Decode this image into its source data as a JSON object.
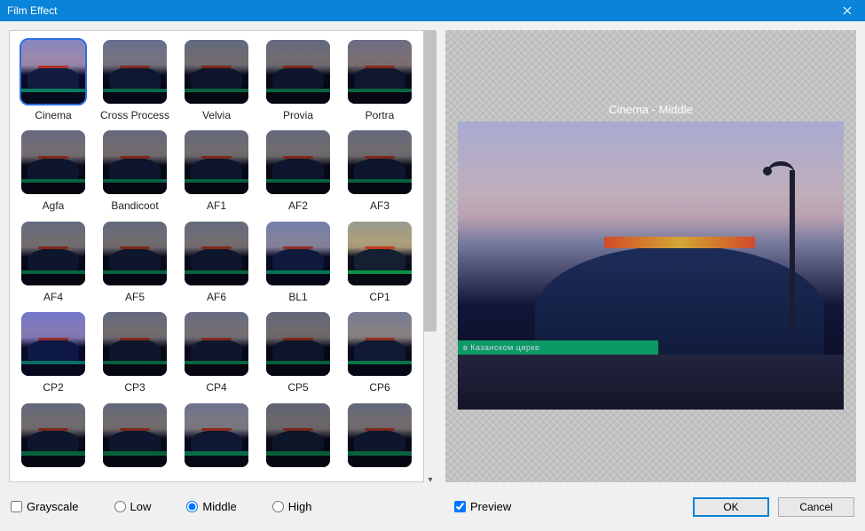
{
  "window": {
    "title": "Film Effect"
  },
  "effects": [
    {
      "label": "Cinema",
      "tint": "#6a5cc8",
      "selected": true
    },
    {
      "label": "Cross Process",
      "tint": "#1a2a60"
    },
    {
      "label": "Velvia",
      "tint": "#101a3a"
    },
    {
      "label": "Provia",
      "tint": "#141c3c"
    },
    {
      "label": "Portra",
      "tint": "#2a2444"
    },
    {
      "label": "Agfa",
      "tint": "#1a1e42"
    },
    {
      "label": "Bandicoot",
      "tint": "#151a38"
    },
    {
      "label": "AF1",
      "tint": "#121a36"
    },
    {
      "label": "AF2",
      "tint": "#121a36"
    },
    {
      "label": "AF3",
      "tint": "#121a36"
    },
    {
      "label": "AF4",
      "tint": "#141e3c"
    },
    {
      "label": "AF5",
      "tint": "#141c38"
    },
    {
      "label": "AF6",
      "tint": "#161e3c"
    },
    {
      "label": "BL1",
      "tint": "#3a4ea0"
    },
    {
      "label": "CP1",
      "tint": "#8c8c56"
    },
    {
      "label": "CP2",
      "tint": "#3a3adf"
    },
    {
      "label": "CP3",
      "tint": "#141a38"
    },
    {
      "label": "CP4",
      "tint": "#1a2242"
    },
    {
      "label": "CP5",
      "tint": "#121630"
    },
    {
      "label": "CP6",
      "tint": "#40486a"
    },
    {
      "label": "",
      "tint": "#131a36"
    },
    {
      "label": "",
      "tint": "#131a36"
    },
    {
      "label": "",
      "tint": "#2a3460"
    },
    {
      "label": "",
      "tint": "#08102a"
    },
    {
      "label": "",
      "tint": "#131a36"
    }
  ],
  "preview": {
    "title": "Cinema - Middle",
    "strip_text": "в Казанском цирке"
  },
  "footer": {
    "grayscale_label": "Grayscale",
    "grayscale_checked": false,
    "intensity": {
      "low": "Low",
      "middle": "Middle",
      "high": "High",
      "selected": "middle"
    },
    "preview_label": "Preview",
    "preview_checked": true,
    "ok": "OK",
    "cancel": "Cancel"
  }
}
